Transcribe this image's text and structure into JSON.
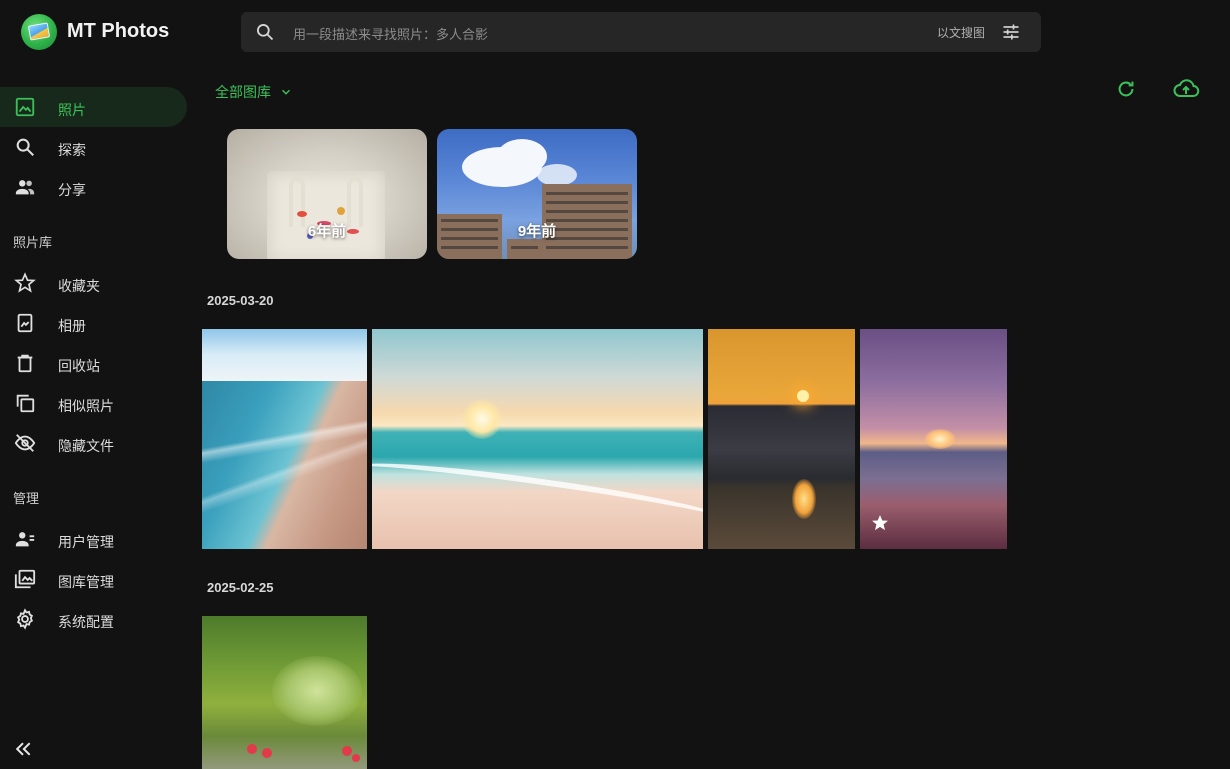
{
  "app": {
    "title": "MT Photos"
  },
  "search": {
    "placeholder": "用一段描述来寻找照片：多人合影",
    "image_search_label": "以文搜图"
  },
  "sidebar": {
    "items": [
      {
        "label": "照片",
        "icon": "photo-icon",
        "active": true
      },
      {
        "label": "探索",
        "icon": "search-icon"
      },
      {
        "label": "分享",
        "icon": "people-icon"
      }
    ],
    "library_section_label": "照片库",
    "library_items": [
      {
        "label": "收藏夹",
        "icon": "star-icon"
      },
      {
        "label": "相册",
        "icon": "album-icon"
      },
      {
        "label": "回收站",
        "icon": "trash-icon"
      },
      {
        "label": "相似照片",
        "icon": "duplicate-icon"
      },
      {
        "label": "隐藏文件",
        "icon": "hidden-icon"
      }
    ],
    "admin_section_label": "管理",
    "admin_items": [
      {
        "label": "用户管理",
        "icon": "user-manage-icon"
      },
      {
        "label": "图库管理",
        "icon": "gallery-manage-icon"
      },
      {
        "label": "系统配置",
        "icon": "settings-icon"
      }
    ]
  },
  "toolbar": {
    "library_selector": "全部图库"
  },
  "memories": [
    {
      "caption": "6年前"
    },
    {
      "caption": "9年前"
    }
  ],
  "groups": [
    {
      "date": "2025-03-20"
    },
    {
      "date": "2025-02-25"
    }
  ],
  "colors": {
    "accent": "#3cc15a",
    "background": "#121212",
    "search_bg": "#262626"
  }
}
